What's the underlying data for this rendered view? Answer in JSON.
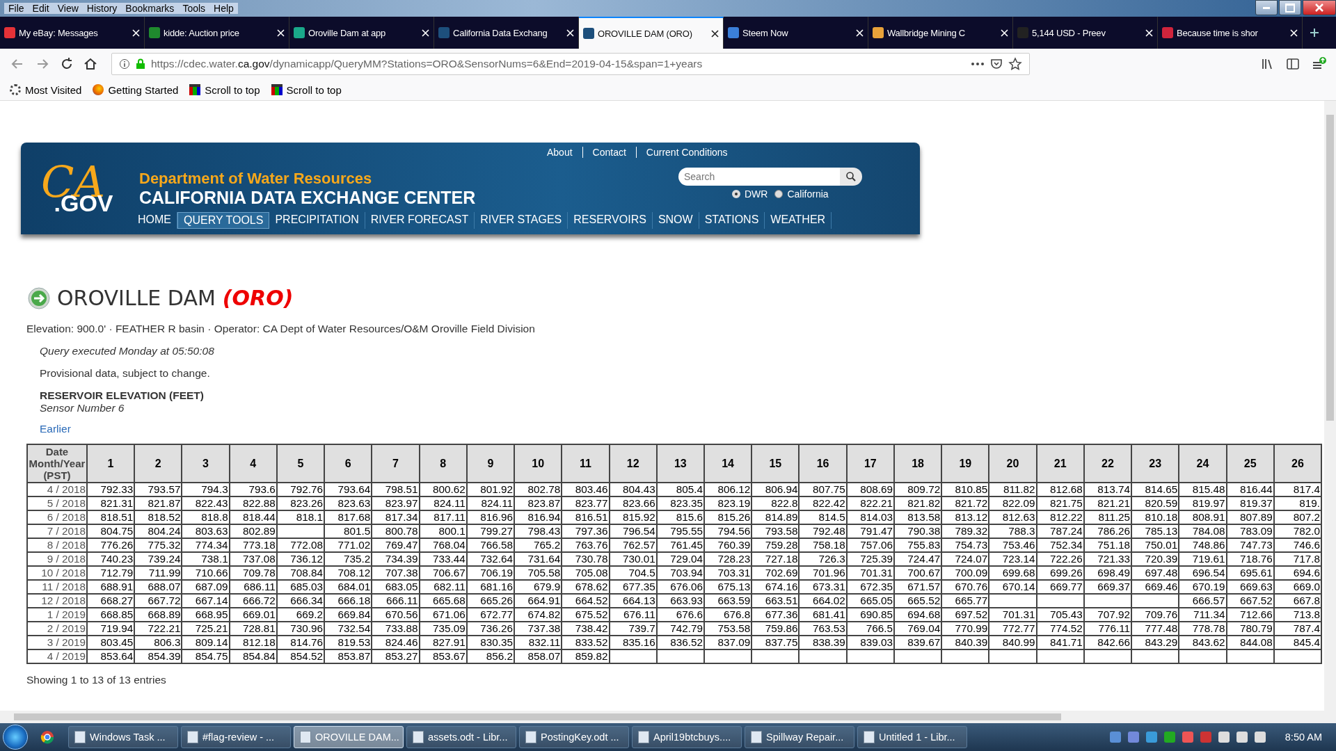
{
  "menu_bar": [
    "File",
    "Edit",
    "View",
    "History",
    "Bookmarks",
    "Tools",
    "Help"
  ],
  "tabs": [
    {
      "label": "My eBay: Messages",
      "selected": false,
      "color": "#e53238"
    },
    {
      "label": "kidde: Auction price",
      "selected": false,
      "color": "#1f8a2e"
    },
    {
      "label": "Oroville Dam at app",
      "selected": false,
      "color": "#1aa88a"
    },
    {
      "label": "California Data Exchang",
      "selected": false,
      "color": "#1d4f7c"
    },
    {
      "label": "OROVILLE DAM (ORO)",
      "selected": true,
      "color": "#1d4f7c"
    },
    {
      "label": "Steem Now",
      "selected": false,
      "color": "#3b7fd9"
    },
    {
      "label": "Wallbridge Mining C",
      "selected": false,
      "color": "#e8a23a"
    },
    {
      "label": "5,144 USD - Preev",
      "selected": false,
      "color": "#222222"
    },
    {
      "label": "Because time is shor",
      "selected": false,
      "color": "#d0243c"
    }
  ],
  "url": {
    "prefix": "https://cdec.water.",
    "domain": "ca.gov",
    "path": "/dynamicapp/QueryMM?Stations=ORO&SensorNums=6&End=2019-04-15&span=1+years"
  },
  "bookmarks": [
    "Most Visited",
    "Getting Started",
    "Scroll to top",
    "Scroll to top"
  ],
  "site": {
    "logo_ca": "CA",
    "logo_gov": ".GOV",
    "department": "Department of Water Resources",
    "center": "CALIFORNIA DATA EXCHANGE CENTER",
    "top_links": [
      "About",
      "Contact",
      "Current Conditions"
    ],
    "search": {
      "placeholder": "Search"
    },
    "scope": [
      {
        "label": "DWR",
        "selected": true
      },
      {
        "label": "California",
        "selected": false
      }
    ],
    "nav": [
      {
        "label": "HOME",
        "selected": false
      },
      {
        "label": "QUERY TOOLS",
        "selected": true
      },
      {
        "label": "PRECIPITATION",
        "selected": false
      },
      {
        "label": "RIVER FORECAST",
        "selected": false
      },
      {
        "label": "RIVER STAGES",
        "selected": false
      },
      {
        "label": "RESERVOIRS",
        "selected": false
      },
      {
        "label": "SNOW",
        "selected": false
      },
      {
        "label": "STATIONS",
        "selected": false
      },
      {
        "label": "WEATHER",
        "selected": false
      }
    ]
  },
  "station": {
    "name": "OROVILLE DAM",
    "code": "(ORO)",
    "info": "Elevation: 900.0' · FEATHER R basin · Operator: CA Dept of Water Resources/O&M Oroville Field Division",
    "query_time": "Query executed Monday at 05:50:08",
    "provisional": "Provisional data, subject to change.",
    "sensor_title": "RESERVOIR ELEVATION (FEET)",
    "sensor_number": "Sensor Number 6",
    "earlier": "Earlier"
  },
  "table": {
    "columns": [
      "Date Month/Year (PST)",
      "1",
      "2",
      "3",
      "4",
      "5",
      "6",
      "7",
      "8",
      "9",
      "10",
      "11",
      "12",
      "13",
      "14",
      "15",
      "16",
      "17",
      "18",
      "19",
      "20",
      "21",
      "22",
      "23",
      "24",
      "25",
      "26"
    ],
    "rows": [
      [
        "4 / 2018",
        "792.33",
        "793.57",
        "794.3",
        "793.6",
        "792.76",
        "793.64",
        "798.51",
        "800.62",
        "801.92",
        "802.78",
        "803.46",
        "804.43",
        "805.4",
        "806.12",
        "806.94",
        "807.75",
        "808.69",
        "809.72",
        "810.85",
        "811.82",
        "812.68",
        "813.74",
        "814.65",
        "815.48",
        "816.44",
        "817.4"
      ],
      [
        "5 / 2018",
        "821.31",
        "821.87",
        "822.43",
        "822.88",
        "823.26",
        "823.63",
        "823.97",
        "824.11",
        "824.11",
        "823.87",
        "823.77",
        "823.66",
        "823.35",
        "823.19",
        "822.8",
        "822.42",
        "822.21",
        "821.82",
        "821.72",
        "822.09",
        "821.75",
        "821.21",
        "820.59",
        "819.97",
        "819.37",
        "819."
      ],
      [
        "6 / 2018",
        "818.51",
        "818.52",
        "818.8",
        "818.44",
        "818.1",
        "817.68",
        "817.34",
        "817.11",
        "816.96",
        "816.94",
        "816.51",
        "815.92",
        "815.6",
        "815.26",
        "814.89",
        "814.5",
        "814.03",
        "813.58",
        "813.12",
        "812.63",
        "812.22",
        "811.25",
        "810.18",
        "808.91",
        "807.89",
        "807.2"
      ],
      [
        "7 / 2018",
        "804.75",
        "804.24",
        "803.63",
        "802.89",
        null,
        "801.5",
        "800.78",
        "800.1",
        "799.27",
        "798.43",
        "797.36",
        "796.54",
        "795.55",
        "794.56",
        "793.58",
        "792.48",
        "791.47",
        "790.38",
        "789.32",
        "788.3",
        "787.24",
        "786.26",
        "785.13",
        "784.08",
        "783.09",
        "782.0"
      ],
      [
        "8 / 2018",
        "776.26",
        "775.32",
        "774.34",
        "773.18",
        "772.08",
        "771.02",
        "769.47",
        "768.04",
        "766.58",
        "765.2",
        "763.76",
        "762.57",
        "761.45",
        "760.39",
        "759.28",
        "758.18",
        "757.06",
        "755.83",
        "754.73",
        "753.46",
        "752.34",
        "751.18",
        "750.01",
        "748.86",
        "747.73",
        "746.6"
      ],
      [
        "9 / 2018",
        "740.23",
        "739.24",
        "738.1",
        "737.08",
        "736.12",
        "735.2",
        "734.39",
        "733.44",
        "732.64",
        "731.64",
        "730.78",
        "730.01",
        "729.04",
        "728.23",
        "727.18",
        "726.3",
        "725.39",
        "724.47",
        "724.07",
        "723.14",
        "722.26",
        "721.33",
        "720.39",
        "719.61",
        "718.76",
        "717.8"
      ],
      [
        "10 / 2018",
        "712.79",
        "711.99",
        "710.66",
        "709.78",
        "708.84",
        "708.12",
        "707.38",
        "706.67",
        "706.19",
        "705.58",
        "705.08",
        "704.5",
        "703.94",
        "703.31",
        "702.69",
        "701.96",
        "701.31",
        "700.67",
        "700.09",
        "699.68",
        "699.26",
        "698.49",
        "697.48",
        "696.54",
        "695.61",
        "694.6"
      ],
      [
        "11 / 2018",
        "688.91",
        "688.07",
        "687.09",
        "686.11",
        "685.03",
        "684.01",
        "683.05",
        "682.11",
        "681.16",
        "679.9",
        "678.62",
        "677.35",
        "676.06",
        "675.13",
        "674.16",
        "673.31",
        "672.35",
        "671.57",
        "670.76",
        "670.14",
        "669.77",
        "669.37",
        "669.46",
        "670.19",
        "669.63",
        "669.0"
      ],
      [
        "12 / 2018",
        "668.27",
        "667.72",
        "667.14",
        "666.72",
        "666.34",
        "666.18",
        "666.11",
        "665.68",
        "665.26",
        "664.91",
        "664.52",
        "664.13",
        "663.93",
        "663.59",
        "663.51",
        "664.02",
        "665.05",
        "665.52",
        "665.77",
        null,
        null,
        null,
        null,
        "666.57",
        "667.52",
        "667.8"
      ],
      [
        "1 / 2019",
        "668.85",
        "668.89",
        "668.95",
        "669.01",
        "669.2",
        "669.84",
        "670.56",
        "671.06",
        "672.77",
        "674.82",
        "675.52",
        "676.11",
        "676.6",
        "676.8",
        "677.36",
        "681.41",
        "690.85",
        "694.68",
        "697.52",
        "701.31",
        "705.43",
        "707.92",
        "709.76",
        "711.34",
        "712.66",
        "713.8"
      ],
      [
        "2 / 2019",
        "719.94",
        "722.21",
        "725.21",
        "728.81",
        "730.96",
        "732.54",
        "733.88",
        "735.09",
        "736.26",
        "737.38",
        "738.42",
        "739.7",
        "742.79",
        "753.58",
        "759.86",
        "763.53",
        "766.5",
        "769.04",
        "770.99",
        "772.77",
        "774.52",
        "776.11",
        "777.48",
        "778.78",
        "780.79",
        "787.4"
      ],
      [
        "3 / 2019",
        "803.45",
        "806.3",
        "809.14",
        "812.18",
        "814.76",
        "819.53",
        "824.46",
        "827.91",
        "830.35",
        "832.11",
        "833.52",
        "835.16",
        "836.52",
        "837.09",
        "837.75",
        "838.39",
        "839.03",
        "839.67",
        "840.39",
        "840.99",
        "841.71",
        "842.66",
        "843.29",
        "843.62",
        "844.08",
        "845.4"
      ],
      [
        "4 / 2019",
        "853.64",
        "854.39",
        "854.75",
        "854.84",
        "854.52",
        "853.87",
        "853.27",
        "853.67",
        "856.2",
        "858.07",
        "859.82",
        null,
        null,
        null,
        null,
        null,
        null,
        null,
        null,
        null,
        null,
        null,
        null,
        null,
        null,
        null
      ]
    ]
  },
  "entries": "Showing 1 to 13 of 13 entries",
  "taskbar": {
    "items": [
      {
        "label": "Windows Task ...",
        "selected": false
      },
      {
        "label": "#flag-review - ...",
        "selected": false
      },
      {
        "label": "OROVILLE DAM...",
        "selected": true
      },
      {
        "label": "assets.odt - Libr...",
        "selected": false
      },
      {
        "label": "PostingKey.odt ...",
        "selected": false
      },
      {
        "label": "April19btcbuys....",
        "selected": false
      },
      {
        "label": "Spillway Repair...",
        "selected": false
      },
      {
        "label": "Untitled 1 - Libr...",
        "selected": false
      }
    ],
    "clock": "8:50 AM"
  }
}
